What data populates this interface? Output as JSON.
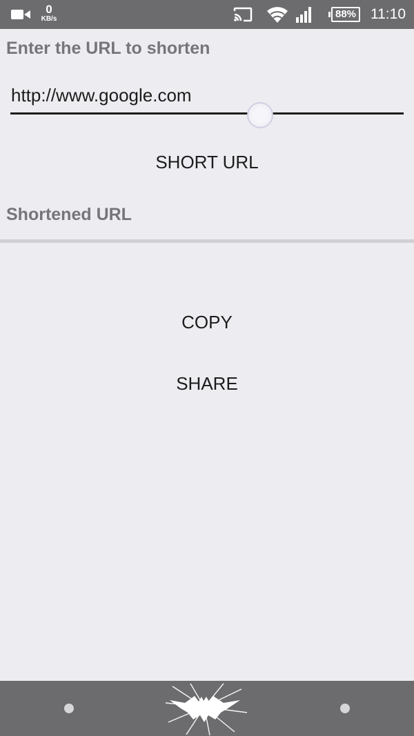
{
  "status_bar": {
    "net_speed_value": "0",
    "net_speed_unit": "KB/s",
    "battery_percent": "88%",
    "time": "11:10",
    "icons": [
      "video-camera-icon",
      "cast-icon",
      "wifi-icon",
      "cell-signal-icon",
      "battery-icon"
    ]
  },
  "main": {
    "input_label": "Enter the URL to shorten",
    "url_value": "http://www.google.com",
    "short_url_button": "SHORT URL",
    "shortened_label": "Shortened URL",
    "copy_button": "COPY",
    "share_button": "SHARE"
  },
  "nav_bar": {
    "icons": [
      "nav-dot-left-icon",
      "bat-logo-icon",
      "nav-dot-right-icon"
    ]
  },
  "colors": {
    "background": "#edecf0",
    "bars": "#6c6b6e",
    "label_text": "#767579",
    "button_text": "#1c1c1c"
  }
}
